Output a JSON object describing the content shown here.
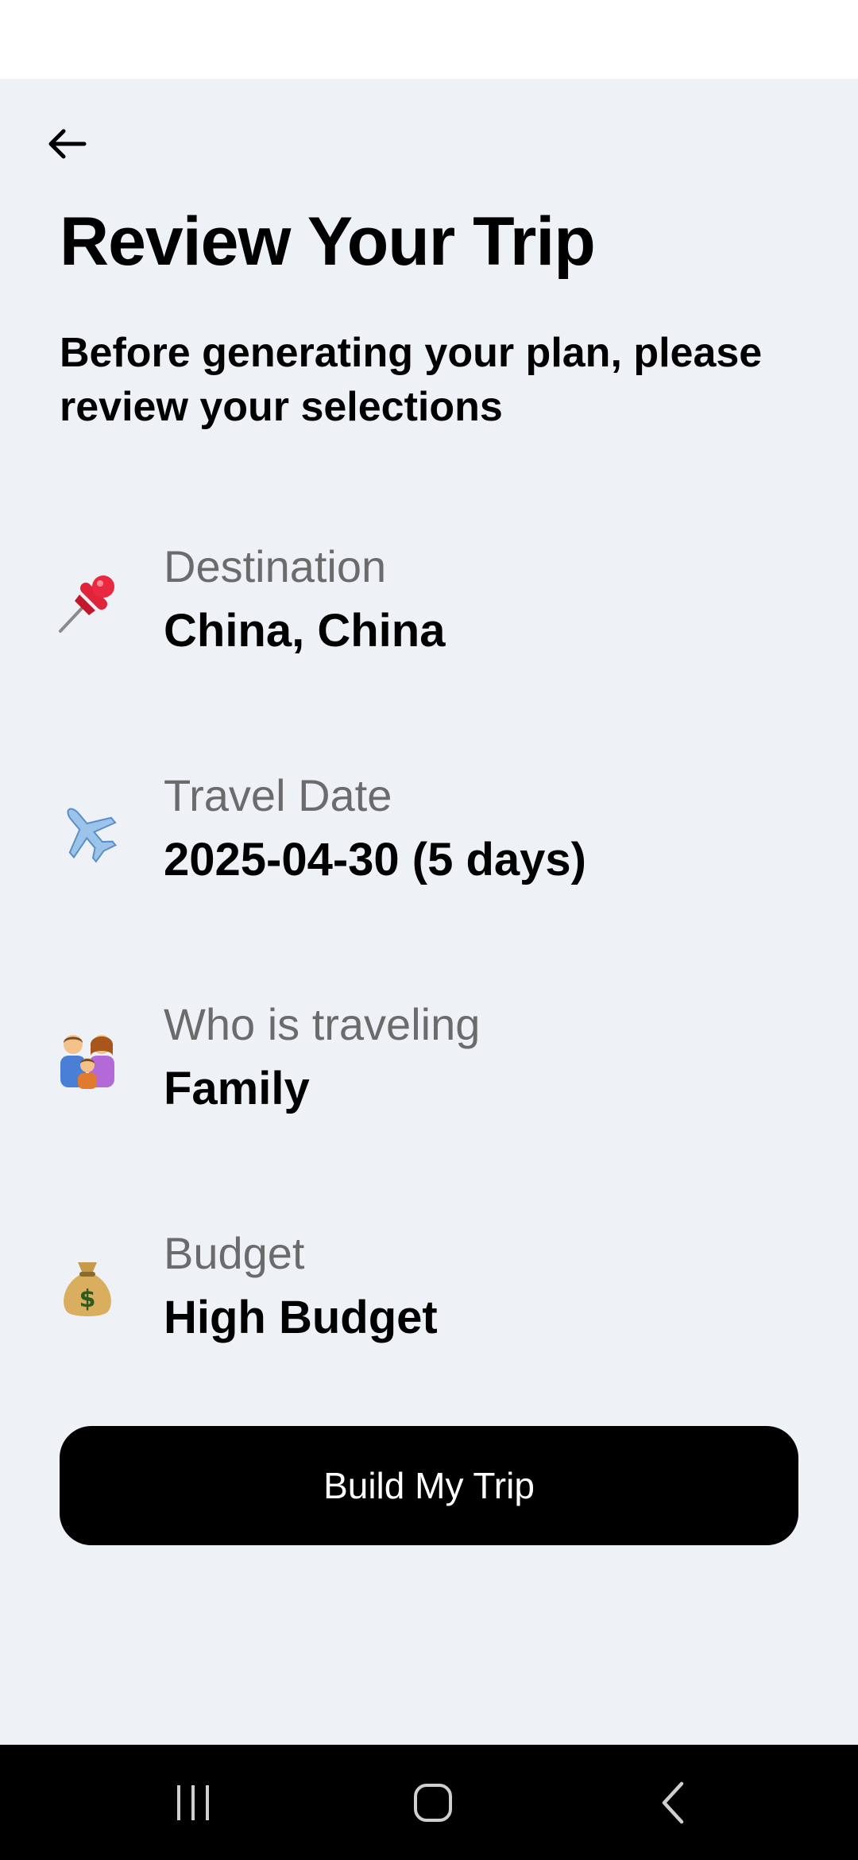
{
  "header": {
    "title": "Review Your Trip",
    "subtitle": "Before generating your plan, please review your selections"
  },
  "items": [
    {
      "icon": "pushpin-icon",
      "label": "Destination",
      "value": "China, China"
    },
    {
      "icon": "airplane-icon",
      "label": "Travel Date",
      "value": "2025-04-30 (5 days)"
    },
    {
      "icon": "family-icon",
      "label": "Who is traveling",
      "value": "Family"
    },
    {
      "icon": "money-bag-icon",
      "label": "Budget",
      "value": "High Budget"
    }
  ],
  "actions": {
    "build_label": "Build My Trip"
  },
  "colors": {
    "background": "#eef2f7",
    "primary_button": "#000000",
    "label_gray": "#6b6b6b"
  }
}
